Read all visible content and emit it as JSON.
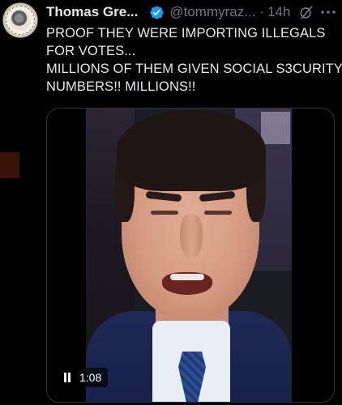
{
  "tweet": {
    "author_name": "Thomas Gre...",
    "handle": "@tommyraz...",
    "separator": "·",
    "time": "14h",
    "text_lines": [
      "PROOF THEY WERE IMPORTING ILLEGALS",
      "FOR VOTES...",
      "MILLIONS OF THEM GIVEN SOCIAL S3CURITY",
      "NUMBERS!! MILLIONS!!"
    ],
    "icons": {
      "verified": "verified-badge-icon",
      "grok": "grok-icon",
      "more": "more-options-icon",
      "pause": "pause-icon"
    },
    "colors": {
      "background": "#000000",
      "text": "#e7e9ea",
      "muted": "#71767b",
      "verified": "#1d9bf0",
      "border": "#2f3336"
    }
  },
  "video": {
    "duration_label": "1:08",
    "state": "playing"
  }
}
